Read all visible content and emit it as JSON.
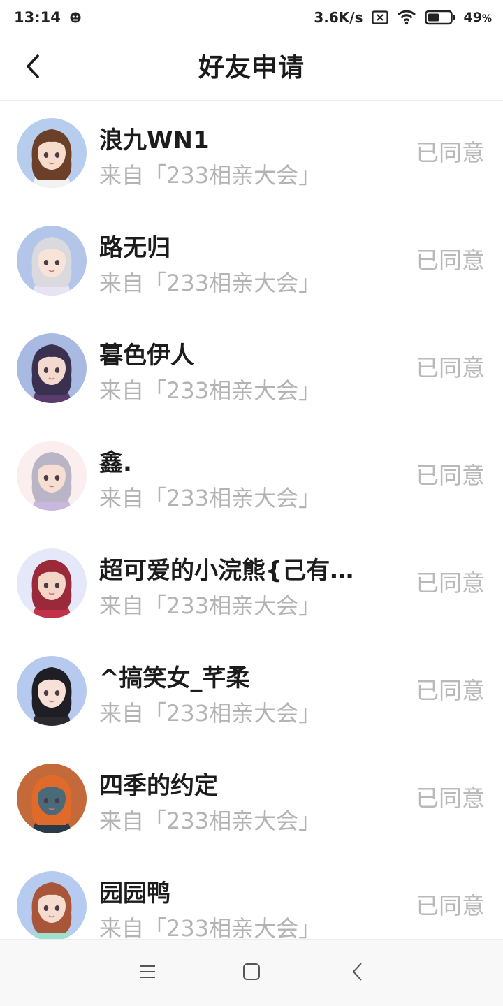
{
  "status_bar": {
    "time": "13:14",
    "net_speed": "3.6K/s",
    "battery": "49",
    "battery_unit": "%"
  },
  "header": {
    "title": "好友申请"
  },
  "requests": [
    {
      "name": "浪九WN1",
      "source": "来自「233相亲大会」",
      "status": "已同意",
      "avatar": {
        "bg": "#b7cdee",
        "hair": "#6b3f28",
        "skin": "#f7dccb",
        "outfit": "#f2f2f2"
      }
    },
    {
      "name": "路无归",
      "source": "来自「233相亲大会」",
      "status": "已同意",
      "avatar": {
        "bg": "#b3c6ea",
        "hair": "#d9d9de",
        "skin": "#f8e3d8",
        "outfit": "#e8e3f3"
      }
    },
    {
      "name": "暮色伊人",
      "source": "来自「233相亲大会」",
      "status": "已同意",
      "avatar": {
        "bg": "#a8b9e2",
        "hair": "#3a3050",
        "skin": "#f4d9cf",
        "outfit": "#5a3c6c"
      }
    },
    {
      "name": "鑫.",
      "source": "来自「233相亲大会」",
      "status": "已同意",
      "avatar": {
        "bg": "#fbeeee",
        "hair": "#b9b4c6",
        "skin": "#f6ded2",
        "outfit": "#c8b8de"
      }
    },
    {
      "name": "超可爱的小浣熊{己有…",
      "source": "来自「233相亲大会」",
      "status": "已同意",
      "avatar": {
        "bg": "#e4e8f8",
        "hair": "#9a2a3a",
        "skin": "#f4d6c6",
        "outfit": "#c2334a"
      }
    },
    {
      "name": "^搞笑女_芊柔",
      "source": "来自「233相亲大会」",
      "status": "已同意",
      "avatar": {
        "bg": "#b6c9ee",
        "hair": "#1e1e24",
        "skin": "#f7e0d6",
        "outfit": "#2a2a30"
      }
    },
    {
      "name": "四季的约定",
      "source": "来自「233相亲大会」",
      "status": "已同意",
      "avatar": {
        "bg": "#c46a3a",
        "hair": "#e06a2a",
        "skin": "#4a6a7a",
        "outfit": "#2a3a4a"
      }
    },
    {
      "name": "园园鸭",
      "source": "来自「233相亲大会」",
      "status": "已同意",
      "avatar": {
        "bg": "#b5cbef",
        "hair": "#a8553a",
        "skin": "#f6dccf",
        "outfit": "#9fe0d0"
      }
    }
  ],
  "icons": {
    "back": "chevron-left-icon",
    "menu": "menu-icon",
    "home": "home-icon",
    "nav_back": "nav-back-icon"
  }
}
